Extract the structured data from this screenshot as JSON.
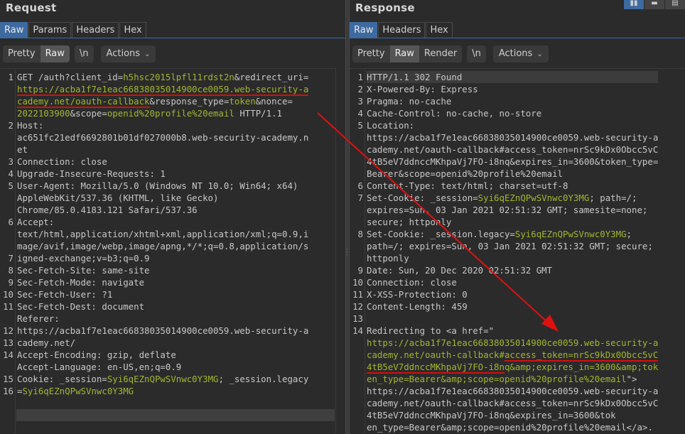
{
  "request": {
    "title": "Request",
    "tabs": [
      "Raw",
      "Params",
      "Headers",
      "Hex"
    ],
    "toolbar": {
      "pretty": "Pretty",
      "raw": "Raw",
      "newline": "\\n",
      "actions": "Actions"
    },
    "line_numbers": [
      "1",
      "",
      "",
      "",
      "2",
      "",
      "",
      "3",
      "4",
      "5",
      "",
      "",
      "6",
      "",
      "",
      "7",
      "8",
      "9",
      "10",
      "11",
      "",
      "12",
      "13",
      "14",
      "",
      "15",
      "16"
    ]
  },
  "response": {
    "title": "Response",
    "tabs": [
      "Raw",
      "Headers",
      "Hex"
    ],
    "toolbar": {
      "pretty": "Pretty",
      "raw": "Raw",
      "render": "Render",
      "newline": "\\n",
      "actions": "Actions"
    },
    "line_numbers": [
      "1",
      "2",
      "3",
      "4",
      "5",
      "",
      "",
      "",
      "",
      "6",
      "7",
      "",
      "",
      "8",
      "",
      "",
      "9",
      "10",
      "11",
      "12",
      "13",
      "14",
      "",
      "",
      "",
      "",
      "",
      ""
    ]
  },
  "colors": {
    "accent": "#3d6aa0",
    "param_value": "#a2b530",
    "arrow": "#e01010"
  },
  "icons": [
    "grip-dots-icon",
    "layout-split-icon",
    "layout-horizontal-icon",
    "layout-tabs-icon",
    "chevron-down-icon"
  ]
}
